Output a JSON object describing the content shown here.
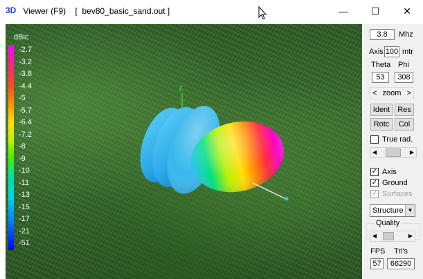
{
  "window": {
    "app_icon_prefix": "3D",
    "title_name": " Viewer (F9)",
    "title_file": "[  bev80_basic_sand.out ]",
    "minimize_glyph": "—",
    "maximize_glyph": "☐",
    "close_glyph": "✕"
  },
  "legend": {
    "unit": "dBic",
    "labels": [
      "-2.7",
      "-3.2",
      "-3.8",
      "-4.4",
      "-5",
      "-5.7",
      "-6.4",
      "-7.2",
      "-8",
      "-9",
      "-10",
      "-11",
      "-13",
      "-15",
      "-17",
      "-21",
      "-51"
    ],
    "gradient_colors": [
      "#ff00ff",
      "#ff4a20",
      "#ffe000",
      "#50f000",
      "#00d8e8",
      "#0000ff"
    ]
  },
  "axis_label": "Z",
  "panel": {
    "frequency_value": "3.8",
    "frequency_unit": "Mhz",
    "axis_label": "Axis",
    "axis_value": "100",
    "axis_unit": "mtr",
    "theta_label": "Theta",
    "phi_label": "Phi",
    "theta_value": "53",
    "phi_value": "308",
    "zoom_left": "<",
    "zoom_label": "zoom",
    "zoom_right": ">",
    "ident_label": "Ident",
    "res_label": "Res",
    "rotc_label": "Rotc",
    "col_label": "Col",
    "true_rad_label": "True rad.",
    "true_rad_checked": false,
    "axis_check_label": "Axis",
    "axis_checked": true,
    "ground_label": "Ground",
    "ground_checked": true,
    "surfaces_label": "Surfaces",
    "surfaces_checked": true,
    "view_mode": "Structure",
    "quality_label": "Quality",
    "fps_label": "FPS",
    "tris_label": "Tri's",
    "fps_value": "57",
    "tris_value": "66290"
  }
}
